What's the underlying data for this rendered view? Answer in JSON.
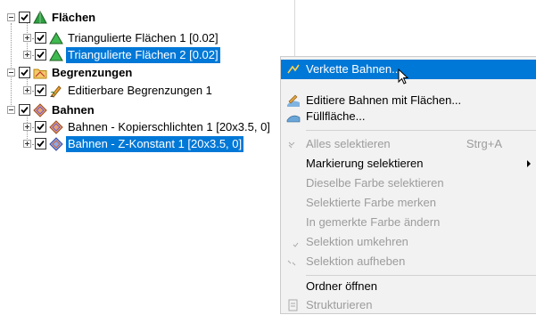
{
  "tree": {
    "groups": [
      {
        "label": "Flächen",
        "icon": "triangle-surface-icon",
        "children": [
          {
            "label": "Triangulierte Flächen 1 [0.02]",
            "icon": "triangle-surface-icon",
            "selected": false
          },
          {
            "label": "Triangulierte Flächen 2 [0.02]",
            "icon": "triangle-surface-icon",
            "selected": true
          }
        ]
      },
      {
        "label": "Begrenzungen",
        "icon": "boundary-folder-icon",
        "children": [
          {
            "label": "Editierbare Begrenzungen 1",
            "icon": "pencil-boundary-icon",
            "selected": false
          }
        ]
      },
      {
        "label": "Bahnen",
        "icon": "toolpath-icon",
        "children": [
          {
            "label": "Bahnen - Kopierschlichten 1 [20x3.5, 0]",
            "icon": "toolpath-icon",
            "selected": false
          },
          {
            "label": "Bahnen - Z-Konstant 1 [20x3.5, 0]",
            "icon": "toolpath-icon",
            "selected": true
          }
        ]
      }
    ]
  },
  "menu": {
    "items": [
      {
        "label": "Verkette Bahnen...",
        "icon": "chain-toolpath-icon",
        "enabled": true,
        "highlighted": true
      },
      {
        "label": "Editiere Bahnen mit Flächen...",
        "icon": "edit-toolpath-surface-icon",
        "enabled": true
      },
      {
        "label": "Füllfläche...",
        "icon": "fill-surface-icon",
        "enabled": true
      },
      {
        "label": "Alles selektieren",
        "shortcut": "Strg+A",
        "icon": "select-all-icon",
        "enabled": false
      },
      {
        "label": "Markierung selektieren",
        "enabled": true,
        "submenu": true
      },
      {
        "label": "Dieselbe Farbe selektieren",
        "enabled": false
      },
      {
        "label": "Selektierte Farbe merken",
        "enabled": false
      },
      {
        "label": "In gemerkte Farbe ändern",
        "enabled": false
      },
      {
        "label": "Selektion umkehren",
        "icon": "invert-selection-icon",
        "enabled": false
      },
      {
        "label": "Selektion aufheben",
        "icon": "deselect-icon",
        "enabled": false
      },
      {
        "label": "Ordner öffnen",
        "enabled": true
      },
      {
        "label": "Strukturieren",
        "icon": "structure-icon",
        "enabled": false
      }
    ]
  },
  "colors": {
    "selection": "#0078d7",
    "menu_bg": "#f2f2f2",
    "disabled_text": "#9c9c9c"
  }
}
